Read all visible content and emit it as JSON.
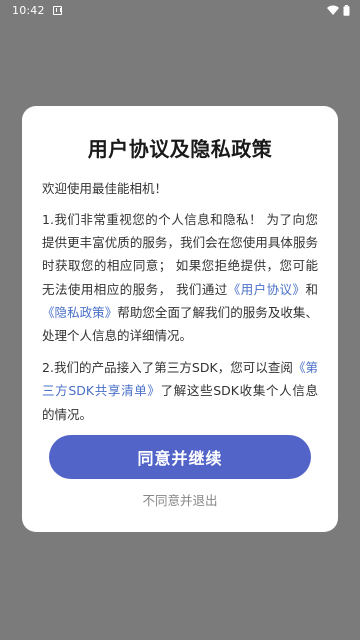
{
  "status_bar": {
    "time": "10:42",
    "notification_icon": "notification-a-icon",
    "wifi_icon": "wifi-icon",
    "battery_icon": "battery-icon"
  },
  "dialog": {
    "title": "用户协议及隐私政策",
    "welcome": "欢迎使用最佳能相机！",
    "para1": {
      "text1": "1.我们非常重视您的个人信息和隐私！ 为了向您提供更丰富优质的服务，我们会在您使用具体服务时获取您的相应同意； 如果您拒绝提供，您可能无法使用相应的服务， 我们通过",
      "link_user_agreement": "《用户协议》",
      "text2": "和",
      "link_privacy_policy": "《隐私政策》",
      "text3": "帮助您全面了解我们的服务及收集、处理个人信息的详细情况。"
    },
    "para2": {
      "text1": "2.我们的产品接入了第三方SDK，您可以查阅",
      "link_sdk_list": "《第三方SDK共享清单》",
      "text2": "了解这些SDK收集个人信息的情况。"
    },
    "agree_label": "同意并继续",
    "disagree_label": "不同意并退出"
  },
  "colors": {
    "overlay": "#7b7b7b",
    "accent": "#5264c8",
    "link": "#4a70c8"
  }
}
